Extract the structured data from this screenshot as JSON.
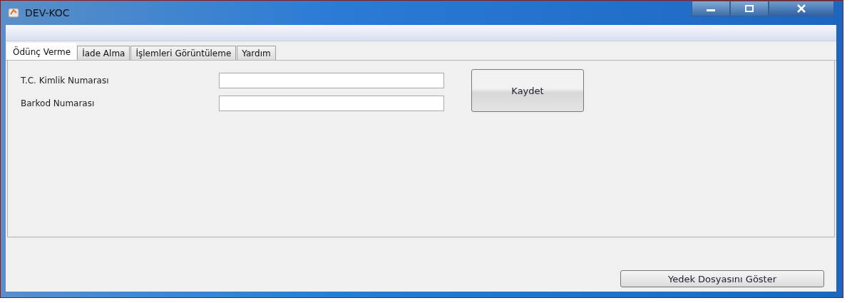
{
  "window": {
    "title": "DEV-KOC"
  },
  "tabs": [
    {
      "label": "Ödünç Verme",
      "selected": true
    },
    {
      "label": "İade Alma",
      "selected": false
    },
    {
      "label": "İşlemleri Görüntüleme",
      "selected": false
    },
    {
      "label": "Yardım",
      "selected": false
    }
  ],
  "form": {
    "fields": [
      {
        "label": "T.C. Kimlik Numarası"
      },
      {
        "label": "Barkod Numarası"
      }
    ],
    "save_button": "Kaydet"
  },
  "footer_button": "Yedek Dosyasını Göster"
}
